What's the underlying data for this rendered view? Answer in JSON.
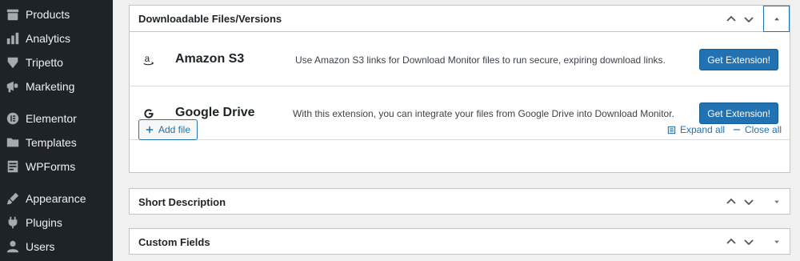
{
  "sidebar": {
    "items": [
      {
        "label": "Products",
        "icon": "products-icon"
      },
      {
        "label": "Analytics",
        "icon": "analytics-icon"
      },
      {
        "label": "Tripetto",
        "icon": "tripetto-icon"
      },
      {
        "label": "Marketing",
        "icon": "marketing-icon"
      },
      {
        "label": "Elementor",
        "icon": "elementor-icon"
      },
      {
        "label": "Templates",
        "icon": "folder-icon"
      },
      {
        "label": "WPForms",
        "icon": "wpforms-icon"
      },
      {
        "label": "Appearance",
        "icon": "brush-icon"
      },
      {
        "label": "Plugins",
        "icon": "plug-icon"
      },
      {
        "label": "Users",
        "icon": "user-icon"
      }
    ]
  },
  "downloadable": {
    "title": "Downloadable Files/Versions",
    "extensions": [
      {
        "name": "Amazon S3",
        "icon": "amazon-icon",
        "description": "Use Amazon S3 links for Download Monitor files to run secure, expiring download links.",
        "button": "Get Extension!"
      },
      {
        "name": "Google Drive",
        "icon": "google-icon",
        "description": "With this extension, you can integrate your files from Google Drive into Download Monitor.",
        "button": "Get Extension!"
      }
    ],
    "add_file": "Add file",
    "expand_all": "Expand all",
    "close_all": "Close all"
  },
  "short_description": {
    "title": "Short Description"
  },
  "custom_fields": {
    "title": "Custom Fields"
  },
  "colors": {
    "sidebar_bg": "#1d2327",
    "accent": "#2271b1",
    "page_bg": "#f0f0f1"
  }
}
